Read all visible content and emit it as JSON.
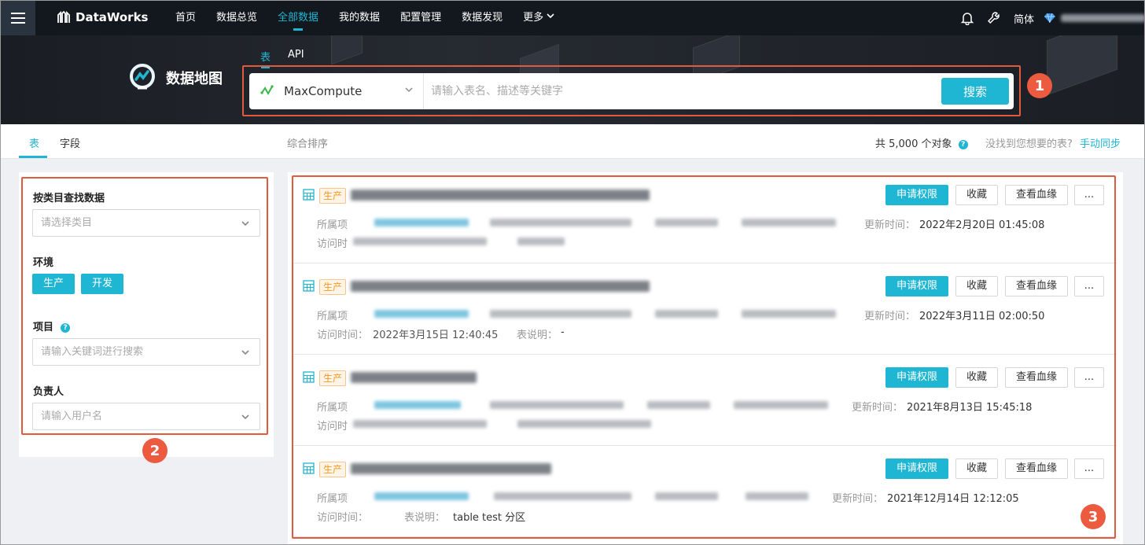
{
  "nav": {
    "logo_text": "DataWorks",
    "items": [
      "首页",
      "数据总览",
      "全部数据",
      "我的数据",
      "配置管理",
      "数据发现",
      "更多"
    ],
    "active_index": 2,
    "lang": "简体"
  },
  "banner": {
    "title": "数据地图",
    "tabs": [
      "表",
      "API"
    ],
    "engine": "MaxCompute",
    "search_placeholder": "请输入表名、描述等关键字",
    "search_button": "搜索"
  },
  "tabbar": {
    "tabs": [
      "表",
      "字段"
    ],
    "sort_label": "综合排序",
    "total": "共 5,000 个对象",
    "missing_text": "没找到您想要的表?",
    "sync_link": "手动同步"
  },
  "filter": {
    "category_label": "按类目查找数据",
    "category_placeholder": "请选择类目",
    "env_label": "环境",
    "env_buttons": [
      "生产",
      "开发"
    ],
    "project_label": "项目",
    "project_placeholder": "请输入关键词进行搜索",
    "owner_label": "负责人",
    "owner_placeholder": "请输入用户名"
  },
  "results": {
    "prod_tag": "生产",
    "actions": [
      "申请权限",
      "收藏",
      "查看血缘",
      "..."
    ],
    "project_label": "所属项",
    "updated_label": "更新时间：",
    "visit_label": "访问时间：",
    "visit_label_short": "访问时",
    "desc_label": "表说明：",
    "items": [
      {
        "updated": "2022年2月20日 01:45:08",
        "visit": "",
        "desc": ""
      },
      {
        "updated": "2022年3月11日 02:00:50",
        "visit": "2022年3月15日 12:40:45",
        "desc": "-"
      },
      {
        "updated": "2021年8月13日 15:45:18",
        "visit": "",
        "desc": ""
      },
      {
        "updated": "2021年12月14日 12:12:05",
        "visit": "",
        "desc": "table test 分区"
      }
    ]
  },
  "annotations": [
    "1",
    "2",
    "3"
  ],
  "colors": {
    "accent": "#1fb6d3",
    "annotation": "#ec5b3f",
    "nav_bg": "#13171e"
  }
}
